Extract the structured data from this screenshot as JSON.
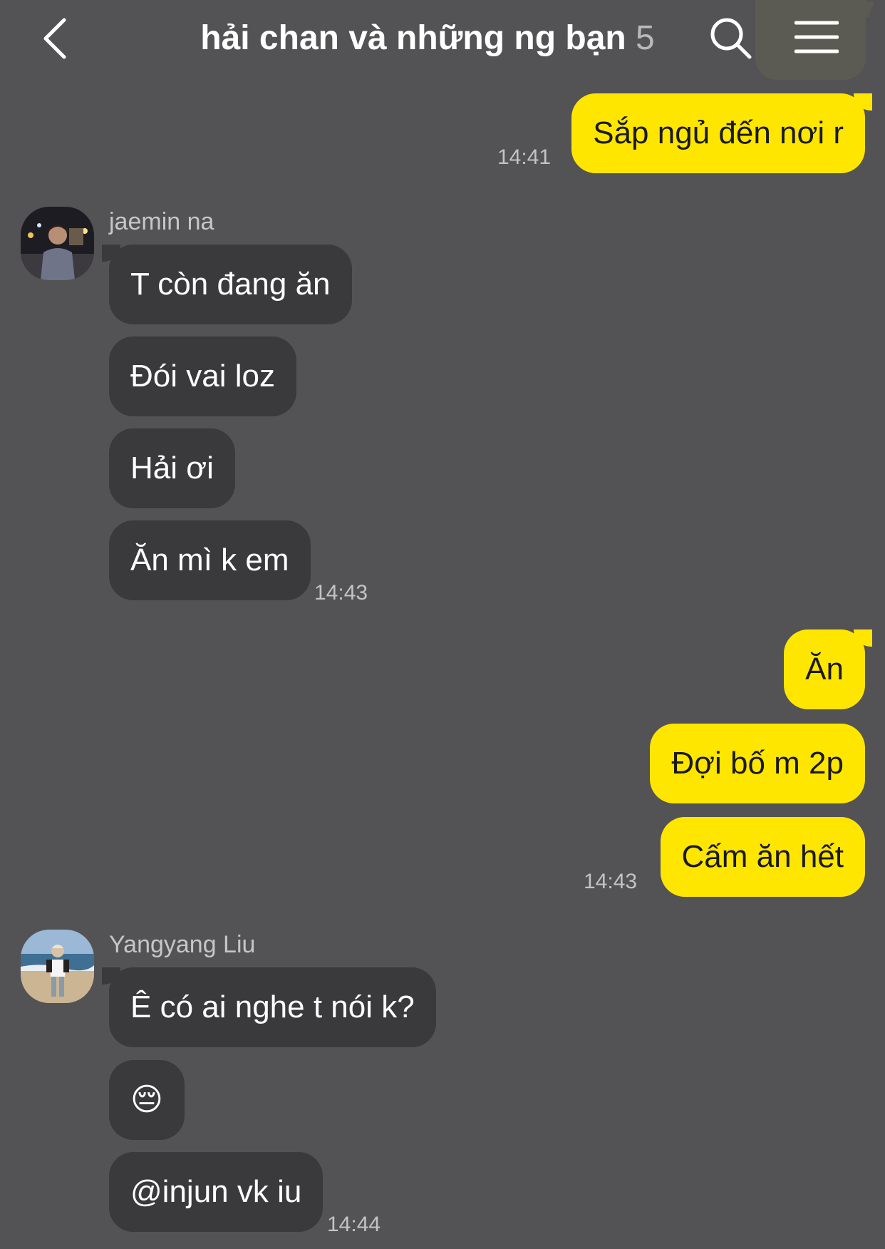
{
  "header": {
    "title": "hải chan và những ng bạn",
    "member_count": "5",
    "back_icon": "chevron-left-icon",
    "search_icon": "search-icon",
    "menu_icon": "hamburger-menu-icon"
  },
  "colors": {
    "background": "#535254",
    "my_bubble": "#ffe600",
    "their_bubble": "#3a393b"
  },
  "messages": {
    "m1": {
      "text": "Sắp ngủ đến nơi r",
      "time": "14:41"
    },
    "group1": {
      "sender": "jaemin na",
      "m1": "T còn đang ăn",
      "m2": "Đói vai loz",
      "m3": "Hải ơi",
      "m4": "Ăn mì k em",
      "time": "14:43"
    },
    "group2": {
      "m1": "Ăn",
      "m2": "Đợi bố m 2p",
      "m3": "Cấm ăn hết",
      "time": "14:43"
    },
    "group3": {
      "sender": "Yangyang Liu",
      "m1": "Ê có ai nghe t nói k?",
      "m2": "😔",
      "m3": "@injun vk iu",
      "time": "14:44"
    }
  }
}
